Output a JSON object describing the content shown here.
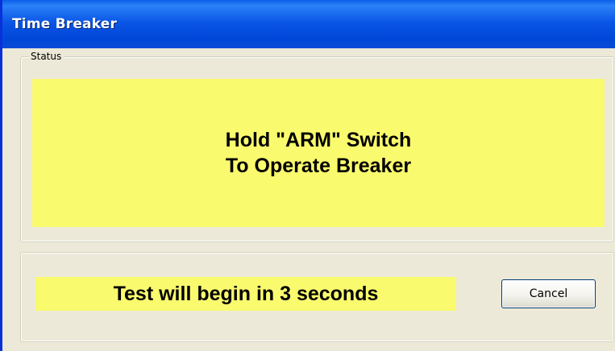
{
  "window": {
    "title": "Time Breaker"
  },
  "status": {
    "legend": "Status",
    "line1": "Hold \"ARM\" Switch",
    "line2": "To Operate Breaker"
  },
  "countdown": {
    "text": "Test will begin in 3 seconds"
  },
  "buttons": {
    "cancel_label": "Cancel"
  },
  "colors": {
    "title_bar": "#0054E3",
    "panel_background": "#FAFA6E",
    "dialog_background": "#ECE9D8"
  }
}
